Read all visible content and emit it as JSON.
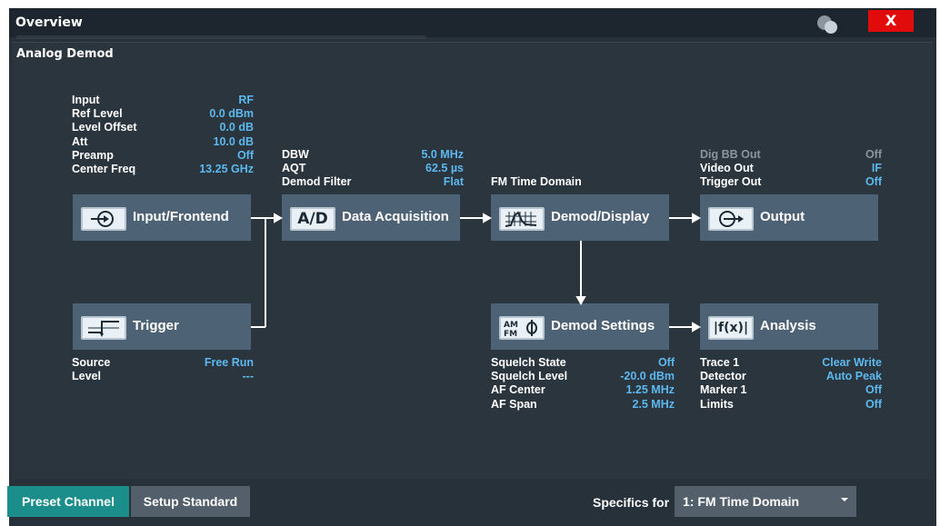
{
  "window": {
    "title": "Overview",
    "close_label": "X"
  },
  "panel": {
    "title": "Analog Demod"
  },
  "input_info": [
    {
      "k": "Input",
      "v": "RF"
    },
    {
      "k": "Ref Level",
      "v": "0.0 dBm"
    },
    {
      "k": "Level Offset",
      "v": "0.0 dB"
    },
    {
      "k": "Att",
      "v": "10.0 dB"
    },
    {
      "k": "Preamp",
      "v": "Off"
    },
    {
      "k": "Center Freq",
      "v": "13.25 GHz"
    }
  ],
  "acq_info": [
    {
      "k": "DBW",
      "v": "5.0 MHz"
    },
    {
      "k": "AQT",
      "v": "62.5 µs"
    },
    {
      "k": "Demod Filter",
      "v": "Flat"
    }
  ],
  "display_info": {
    "label": "FM Time Domain"
  },
  "output_info": [
    {
      "k": "Dig BB Out",
      "v": "Off"
    },
    {
      "k": "Video Out",
      "v": "IF"
    },
    {
      "k": "Trigger Out",
      "v": "Off"
    }
  ],
  "trigger_info": [
    {
      "k": "Source",
      "v": "Free Run"
    },
    {
      "k": "Level",
      "v": "---"
    }
  ],
  "demod_settings_info": [
    {
      "k": "Squelch State",
      "v": "Off"
    },
    {
      "k": "Squelch Level",
      "v": "-20.0 dBm"
    },
    {
      "k": "AF Center",
      "v": "1.25 MHz"
    },
    {
      "k": "AF Span",
      "v": "2.5 MHz"
    }
  ],
  "analysis_info": [
    {
      "k": "Trace 1",
      "v": "Clear Write"
    },
    {
      "k": "Detector",
      "v": "Auto Peak"
    },
    {
      "k": "Marker 1",
      "v": "Off"
    },
    {
      "k": "Limits",
      "v": "Off"
    }
  ],
  "blocks": {
    "input": {
      "label": "Input/Frontend",
      "icon": "input-arrow-icon"
    },
    "acq": {
      "label": "Data Acquisition",
      "icon_text": "A/D",
      "icon": "ad-converter-icon"
    },
    "display": {
      "label": "Demod/Display",
      "icon": "spectrum-display-icon"
    },
    "output": {
      "label": "Output",
      "icon": "output-arrow-icon"
    },
    "trigger": {
      "label": "Trigger",
      "icon": "trigger-edge-icon"
    },
    "demod": {
      "label": "Demod Settings",
      "icon_text": "AM FM",
      "icon": "am-fm-icon"
    },
    "analysis": {
      "label": "Analysis",
      "icon_text": "|f(x)|",
      "icon": "function-icon"
    }
  },
  "footer": {
    "preset_label": "Preset Channel",
    "setup_label": "Setup Standard",
    "specifics_label": "Specifics for",
    "specifics_value": "1: FM Time Domain"
  },
  "colors": {
    "accent": "#5cb8ef",
    "block": "#4e6275",
    "close": "#e20b0b",
    "preset": "#1b8d8a"
  }
}
